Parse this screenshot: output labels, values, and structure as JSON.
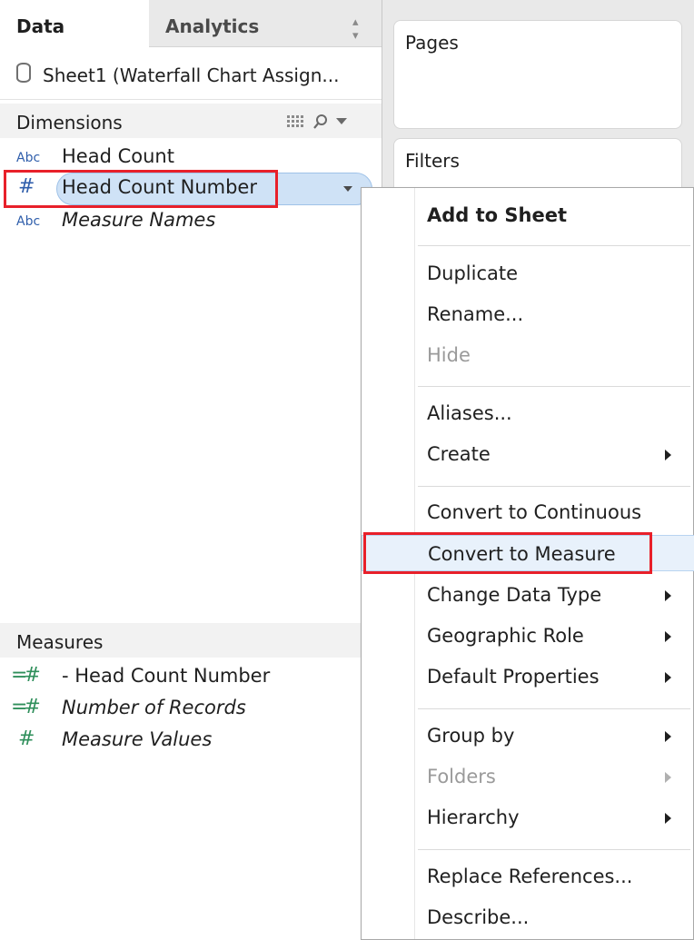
{
  "tabs": {
    "data": "Data",
    "analytics": "Analytics"
  },
  "datasource": {
    "name": "Sheet1 (Waterfall Chart Assign..."
  },
  "dimensions": {
    "title": "Dimensions",
    "items": [
      {
        "type": "Abc",
        "label": "Head Count",
        "italic": false
      },
      {
        "type": "#",
        "label": "Head Count Number",
        "italic": false,
        "selected": true
      },
      {
        "type": "Abc",
        "label": "Measure Names",
        "italic": true
      }
    ]
  },
  "measures": {
    "title": "Measures",
    "items": [
      {
        "type": "=#",
        "label": "- Head Count Number",
        "italic": false
      },
      {
        "type": "=#",
        "label": "Number of Records",
        "italic": true
      },
      {
        "type": "#",
        "label": "Measure Values",
        "italic": true
      }
    ]
  },
  "shelves": {
    "pages": "Pages",
    "filters": "Filters"
  },
  "context_menu": {
    "items": [
      {
        "label": "Add to Sheet",
        "bold": true
      },
      {
        "label": "Duplicate"
      },
      {
        "label": "Rename..."
      },
      {
        "label": "Hide",
        "disabled": true
      },
      {
        "label": "Aliases..."
      },
      {
        "label": "Create",
        "submenu": true
      },
      {
        "label": "Convert to Continuous"
      },
      {
        "label": "Convert to Measure",
        "highlighted": true
      },
      {
        "label": "Change Data Type",
        "submenu": true
      },
      {
        "label": "Geographic Role",
        "submenu": true
      },
      {
        "label": "Default Properties",
        "submenu": true
      },
      {
        "label": "Group by",
        "submenu": true
      },
      {
        "label": "Folders",
        "submenu": true,
        "disabled": true
      },
      {
        "label": "Hierarchy",
        "submenu": true
      },
      {
        "label": "Replace References..."
      },
      {
        "label": "Describe..."
      }
    ]
  },
  "colors": {
    "highlight_box": "#e8202a",
    "dimension_type": "#2f5eab",
    "measure_type": "#2f8f5b",
    "selection": "#cfe2f6"
  }
}
